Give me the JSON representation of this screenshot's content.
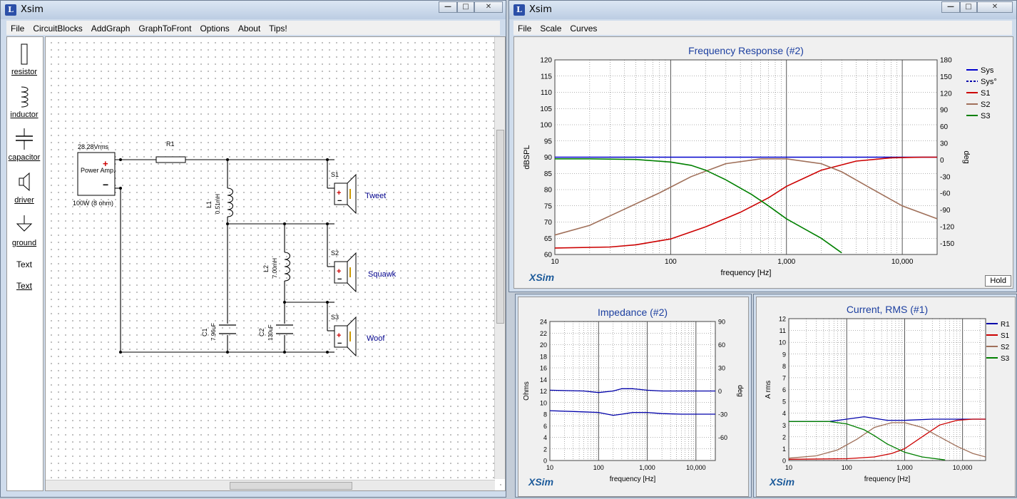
{
  "xsim_main": {
    "title": "Xsim",
    "menu": [
      "File",
      "CircuitBlocks",
      "AddGraph",
      "GraphToFront",
      "Options",
      "About",
      "Tips!"
    ],
    "palette": [
      {
        "label": "resistor",
        "icon": "resistor-icon"
      },
      {
        "label": "inductor",
        "icon": "inductor-icon"
      },
      {
        "label": "capacitor",
        "icon": "capacitor-icon"
      },
      {
        "label": "driver",
        "icon": "speaker-icon"
      },
      {
        "label": "ground",
        "icon": "ground-icon"
      },
      {
        "label": "Text",
        "icon": "text-tool"
      },
      {
        "label": "Text",
        "icon": "text-tool"
      }
    ],
    "circuit": {
      "source_voltage": "28.28Vrms",
      "source_name": "Power Amp.",
      "source_rating": "100W (8 ohm)",
      "r1": "R1",
      "l1": "L1",
      "l1_value": "0.51mH",
      "l2": "L2",
      "l2_value": "7.00mH",
      "c1": "C1",
      "c1_value": "7.96uF",
      "c2": "C2",
      "c2_value": "130uF",
      "drivers": [
        {
          "id": "S1",
          "name": "Tweet"
        },
        {
          "id": "S2",
          "name": "Squawk"
        },
        {
          "id": "S3",
          "name": "Woof"
        }
      ]
    }
  },
  "graph_window": {
    "title": "Xsim",
    "menu": [
      "File",
      "Scale",
      "Curves"
    ],
    "hold_label": "Hold"
  },
  "watermark": "XSim",
  "x_tick_labels": [
    "10",
    "100",
    "1,000",
    "10,000"
  ],
  "xlabel": "frequency [Hz]",
  "chart_data": [
    {
      "type": "line",
      "title": "Frequency Response (#2)",
      "xlabel": "frequency [Hz]",
      "ylabel": "dBSPL",
      "y2label": "deg",
      "xscale": "log",
      "xlim": [
        10,
        20000
      ],
      "ylim": [
        60,
        120
      ],
      "y2lim": [
        -170,
        180
      ],
      "yticks": [
        60,
        65,
        70,
        75,
        80,
        85,
        90,
        95,
        100,
        105,
        110,
        115,
        120
      ],
      "y2ticks": [
        180,
        150,
        120,
        90,
        60,
        30,
        0,
        -30,
        -60,
        -90,
        -120,
        -150
      ],
      "legend_position": "right",
      "colors": {
        "Sys": "#0000cc",
        "S1": "#cc0000",
        "S2": "#a0705a",
        "S3": "#008000"
      },
      "series": [
        {
          "name": "Sys",
          "line": "solid",
          "x": [
            10,
            20000
          ],
          "y": [
            90,
            90
          ]
        },
        {
          "name": "Sys°",
          "line": "dashed",
          "x": [],
          "y": []
        },
        {
          "name": "S1",
          "line": "solid",
          "x": [
            10,
            30,
            50,
            100,
            200,
            400,
            700,
            1000,
            2000,
            4000,
            8000,
            15000,
            20000
          ],
          "y": [
            62,
            62.3,
            63,
            64.8,
            68.5,
            73,
            77.5,
            81,
            86,
            88.8,
            89.8,
            90,
            90
          ]
        },
        {
          "name": "S2",
          "line": "solid",
          "x": [
            10,
            20,
            40,
            80,
            150,
            300,
            600,
            1000,
            2000,
            3000,
            5000,
            10000,
            20000
          ],
          "y": [
            66,
            69,
            74,
            79,
            84,
            88,
            89.5,
            89.5,
            88,
            85.5,
            81,
            75,
            71
          ]
        },
        {
          "name": "S3",
          "line": "solid",
          "x": [
            10,
            20,
            50,
            100,
            150,
            200,
            300,
            500,
            700,
            1000,
            1500,
            2000,
            3000
          ],
          "y": [
            89.5,
            89.5,
            89.3,
            88.5,
            87.5,
            86,
            83,
            78.5,
            75,
            71,
            67.5,
            65,
            60.5
          ]
        }
      ]
    },
    {
      "type": "line",
      "title": "Impedance (#2)",
      "xlabel": "frequency [Hz]",
      "ylabel": "Ohms",
      "y2label": "deg",
      "xscale": "log",
      "xlim": [
        10,
        25000
      ],
      "ylim": [
        0,
        24
      ],
      "y2lim": [
        -90,
        90
      ],
      "yticks": [
        0,
        2,
        4,
        6,
        8,
        10,
        12,
        14,
        16,
        18,
        20,
        22,
        24
      ],
      "y2ticks": [
        90,
        60,
        30,
        0,
        -30,
        -60
      ],
      "colors": {
        "magnitude": "#0000aa",
        "phase": "#0000aa"
      },
      "series": [
        {
          "name": "",
          "axis": "left",
          "x": [
            10,
            50,
            100,
            200,
            300,
            500,
            1000,
            2000,
            5000,
            10000,
            25000
          ],
          "y": [
            8.6,
            8.4,
            8.3,
            7.8,
            8.0,
            8.3,
            8.3,
            8.1,
            8.0,
            8.0,
            8.0
          ]
        },
        {
          "name": "",
          "axis": "right",
          "x": [
            10,
            50,
            100,
            200,
            300,
            500,
            1000,
            2000,
            5000,
            10000,
            25000
          ],
          "y": [
            1,
            0,
            -2,
            0,
            3,
            3,
            1,
            0,
            0,
            0,
            0
          ]
        }
      ]
    },
    {
      "type": "line",
      "title": "Current, RMS (#1)",
      "xlabel": "frequency [Hz]",
      "ylabel": "A rms",
      "xscale": "log",
      "xlim": [
        10,
        25000
      ],
      "ylim": [
        0,
        12
      ],
      "yticks": [
        0,
        1,
        2,
        3,
        4,
        5,
        6,
        7,
        8,
        9,
        10,
        11,
        12
      ],
      "legend_position": "right",
      "colors": {
        "R1": "#0000aa",
        "S1": "#cc0000",
        "S2": "#a0705a",
        "S3": "#008000"
      },
      "series": [
        {
          "name": "R1",
          "x": [
            10,
            50,
            100,
            200,
            500,
            1000,
            3000,
            10000,
            25000
          ],
          "y": [
            3.3,
            3.3,
            3.5,
            3.7,
            3.4,
            3.4,
            3.5,
            3.5,
            3.5
          ]
        },
        {
          "name": "S1",
          "x": [
            10,
            100,
            300,
            600,
            1000,
            2000,
            4000,
            8000,
            15000,
            25000
          ],
          "y": [
            0.1,
            0.15,
            0.3,
            0.6,
            1.0,
            2.0,
            3.0,
            3.4,
            3.5,
            3.5
          ]
        },
        {
          "name": "S2",
          "x": [
            10,
            30,
            70,
            150,
            300,
            600,
            1000,
            2000,
            4000,
            8000,
            15000,
            25000
          ],
          "y": [
            0.2,
            0.4,
            0.9,
            1.8,
            2.8,
            3.2,
            3.2,
            2.8,
            2.0,
            1.2,
            0.6,
            0.3
          ]
        },
        {
          "name": "S3",
          "x": [
            10,
            50,
            100,
            200,
            300,
            500,
            1000,
            2000,
            5000
          ],
          "y": [
            3.3,
            3.3,
            3.1,
            2.6,
            2.1,
            1.4,
            0.7,
            0.3,
            0.05
          ]
        }
      ]
    }
  ]
}
